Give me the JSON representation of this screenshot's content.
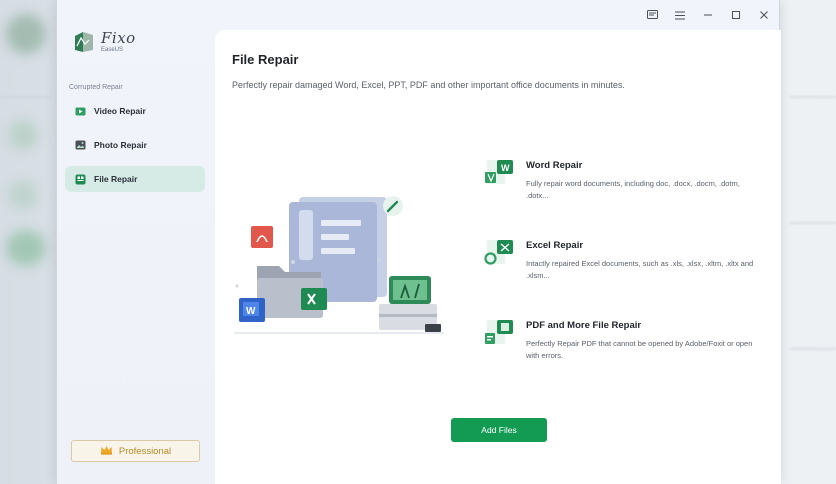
{
  "app": {
    "logo_name": "Fixo",
    "logo_sub": "EaseUS"
  },
  "sidebar": {
    "section_label": "Corrupted Repair",
    "items": [
      {
        "label": "Video Repair",
        "icon": "video-icon"
      },
      {
        "label": "Photo Repair",
        "icon": "photo-icon"
      },
      {
        "label": "File Repair",
        "icon": "file-icon",
        "active": true
      }
    ],
    "professional_label": "Professional"
  },
  "titlebar": {
    "buttons": [
      "feedback-icon",
      "menu-icon",
      "minimize-icon",
      "maximize-icon",
      "close-icon"
    ]
  },
  "main": {
    "title": "File Repair",
    "description": "Perfectly repair damaged Word, Excel, PPT, PDF and other important office documents in minutes.",
    "features": [
      {
        "title": "Word Repair",
        "description": "Fully repair word documents, including doc, .docx, .docm, .dotm, .dotx..."
      },
      {
        "title": "Excel Repair",
        "description": "Intactly repaired Excel documents, such as .xls, .xlsx, .xltm, .xltx and .xlsm..."
      },
      {
        "title": "PDF and More File Repair",
        "description": "Perfectly Repair PDF that cannot be opened by Adobe/Foxit or open with errors."
      }
    ],
    "add_files_label": "Add Files"
  },
  "colors": {
    "accent": "#139b54",
    "active_nav_bg": "#d7ebe6",
    "professional": "#b98a26"
  }
}
